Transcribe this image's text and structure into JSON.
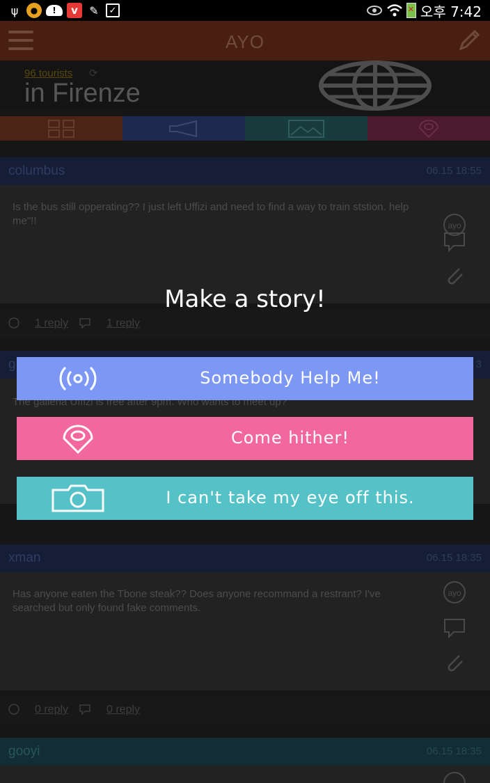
{
  "status_bar": {
    "time": "오후 7:42",
    "left_icons": [
      "usb-icon",
      "avatar-notification-icon",
      "cloud-warning-icon",
      "vivaldi-icon",
      "pen-icon",
      "clipboard-check-icon"
    ],
    "right_icons": [
      "eye-icon",
      "wifi-icon",
      "battery-icon"
    ]
  },
  "app_bar": {
    "title": "AYO"
  },
  "city": {
    "tourists_label": "96 tourists",
    "name": "in Firenze"
  },
  "tabs": [
    {
      "name": "grid",
      "color": "#5c2c1b"
    },
    {
      "name": "megaphone",
      "color": "#263262"
    },
    {
      "name": "image",
      "color": "#1e4a4c"
    },
    {
      "name": "pin",
      "color": "#5c2238"
    }
  ],
  "posts": [
    {
      "user": "columbus",
      "date": "06.15  18:55",
      "message": "Is the bus still opperating??  I just left Uffizi and need to find a way to train ststion. help me\"!!",
      "reply_a": "1 reply",
      "reply_b": "1 reply"
    },
    {
      "user": "g",
      "date": "3",
      "message": "The galleria Uffizi is free after 9pm. Who wants to meet up?",
      "reply_a": "",
      "reply_b": ""
    },
    {
      "user": "xman",
      "date": "06.15  18:35",
      "message": "Has anyone eaten the Tbone steak?? Does anyone recommand a restrant? I've searched but only found fake comments.",
      "reply_a": "0 reply",
      "reply_b": "0 reply"
    },
    {
      "user": "gooyi",
      "date": "06.15  18:35",
      "message": "",
      "reply_a": "",
      "reply_b": ""
    }
  ],
  "dialog": {
    "title": "Make a story!",
    "actions": [
      {
        "label": "Somebody Help Me!",
        "icon": "broadcast-icon",
        "color": "#7d98f4"
      },
      {
        "label": "Come hither!",
        "icon": "location-pin-icon",
        "color": "#f2679d"
      },
      {
        "label": "I can't take my eye off this.",
        "icon": "camera-icon",
        "color": "#55c2c8"
      }
    ]
  }
}
